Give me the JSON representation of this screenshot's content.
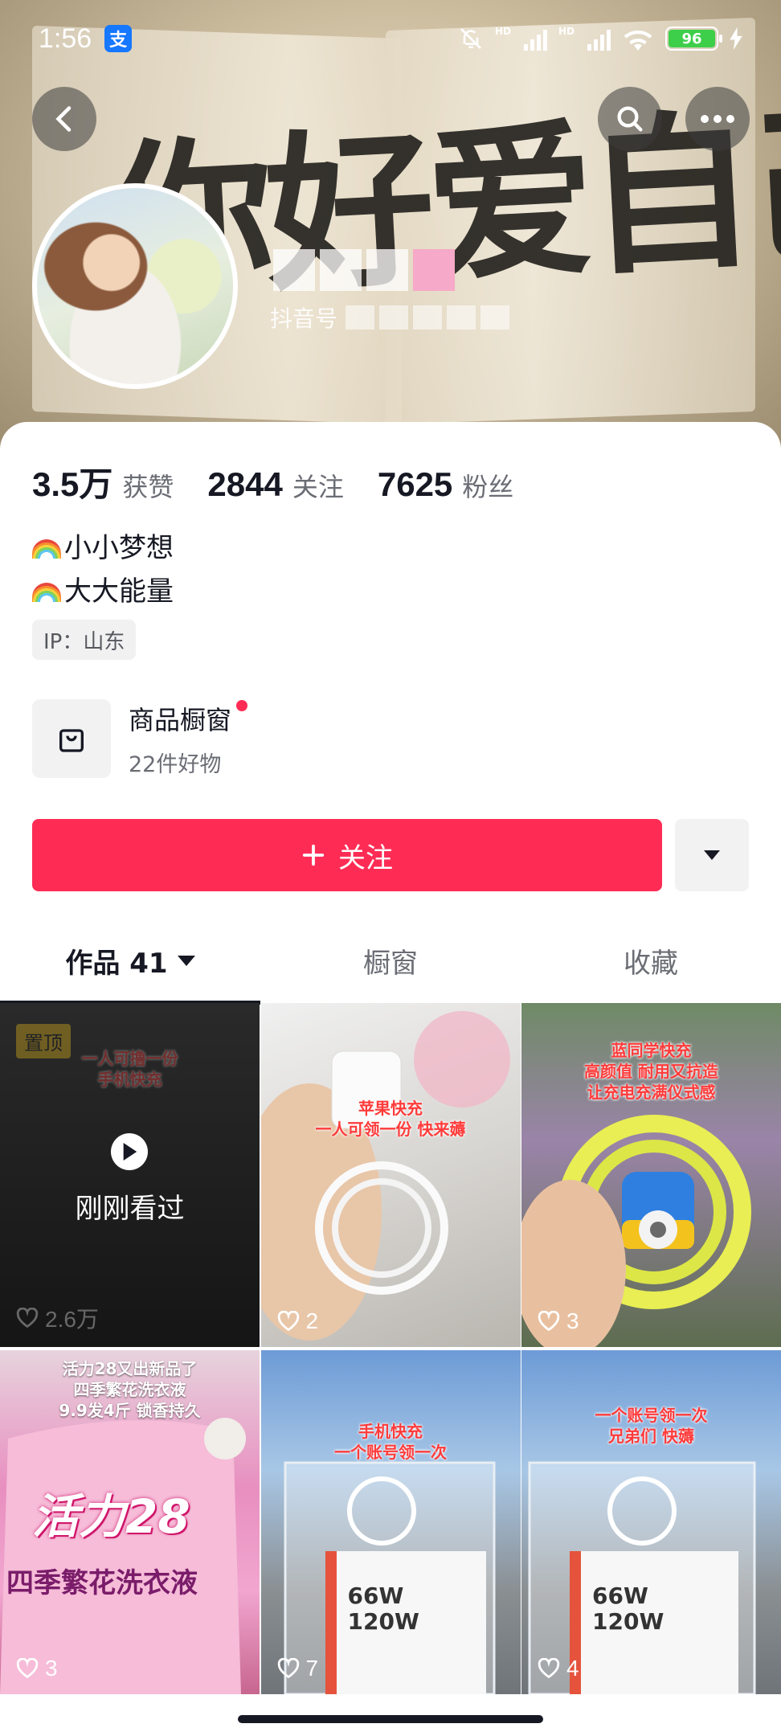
{
  "status_bar": {
    "time": "1:56",
    "alipay": "支",
    "battery": "96"
  },
  "banner": {
    "calligraphy": "你好爱自己"
  },
  "profile": {
    "douyin_id_label": "抖音号"
  },
  "stats": [
    {
      "value": "3.5万",
      "label": "获赞"
    },
    {
      "value": "2844",
      "label": "关注"
    },
    {
      "value": "7625",
      "label": "粉丝"
    }
  ],
  "bio": {
    "line1": "小小梦想",
    "line2": "大大能量",
    "ip": "IP：山东"
  },
  "shop": {
    "title": "商品橱窗",
    "subtitle": "22件好物"
  },
  "follow_button": {
    "label": "关注"
  },
  "tabs": [
    {
      "label": "作品 41"
    },
    {
      "label": "橱窗"
    },
    {
      "label": "收藏"
    }
  ],
  "videos": [
    {
      "pinned": "置顶",
      "status": "刚刚看过",
      "likes": "2.6万",
      "caption": "一人可撸一份\n手机快充"
    },
    {
      "likes": "2",
      "caption": "苹果快充\n一人可领一份 快来薅"
    },
    {
      "likes": "3",
      "caption": "蓝同学快充\n高颜值 耐用又抗造\n让充电充满仪式感"
    },
    {
      "likes": "3",
      "caption": "活力28又出新品了\n四季繁花洗衣液\n9.9发4斤 锁香持久",
      "product_brand": "活力28",
      "product_name": "四季繁花洗衣液"
    },
    {
      "likes": "7",
      "caption": "手机快充\n一个账号领一次",
      "product_label": "66W\n120W"
    },
    {
      "likes": "4",
      "caption": "一个账号领一次\n兄弟们 快薅",
      "product_label": "66W\n120W"
    }
  ]
}
